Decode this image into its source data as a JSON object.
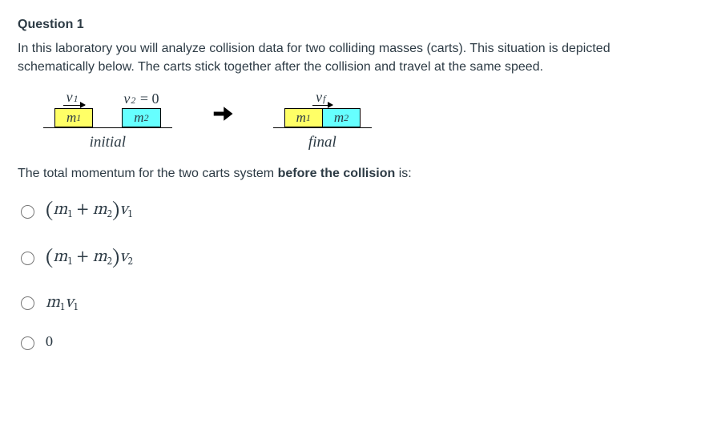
{
  "question": {
    "title": "Question 1",
    "text": "In this laboratory you will analyze collision data for two colliding masses (carts). This situation is depicted schematically below. The carts stick together after the collision and travel at the same speed.",
    "ask_prefix": "The total momentum for the two carts system ",
    "ask_bold": "before the collision",
    "ask_suffix": " is:"
  },
  "diagram": {
    "initial": {
      "v1": "v₁",
      "v2": "v₂ = 0",
      "m1": "m₁",
      "m2": "m₂",
      "label": "initial"
    },
    "final": {
      "vf": "v_f",
      "m1": "m₁",
      "m2": "m₂",
      "label": "final"
    }
  },
  "options": [
    {
      "id": "opt-a",
      "latex": "(m1 + m2) v1"
    },
    {
      "id": "opt-b",
      "latex": "(m1 + m2) v2"
    },
    {
      "id": "opt-c",
      "latex": "m1 v1"
    },
    {
      "id": "opt-d",
      "latex": "0"
    }
  ]
}
